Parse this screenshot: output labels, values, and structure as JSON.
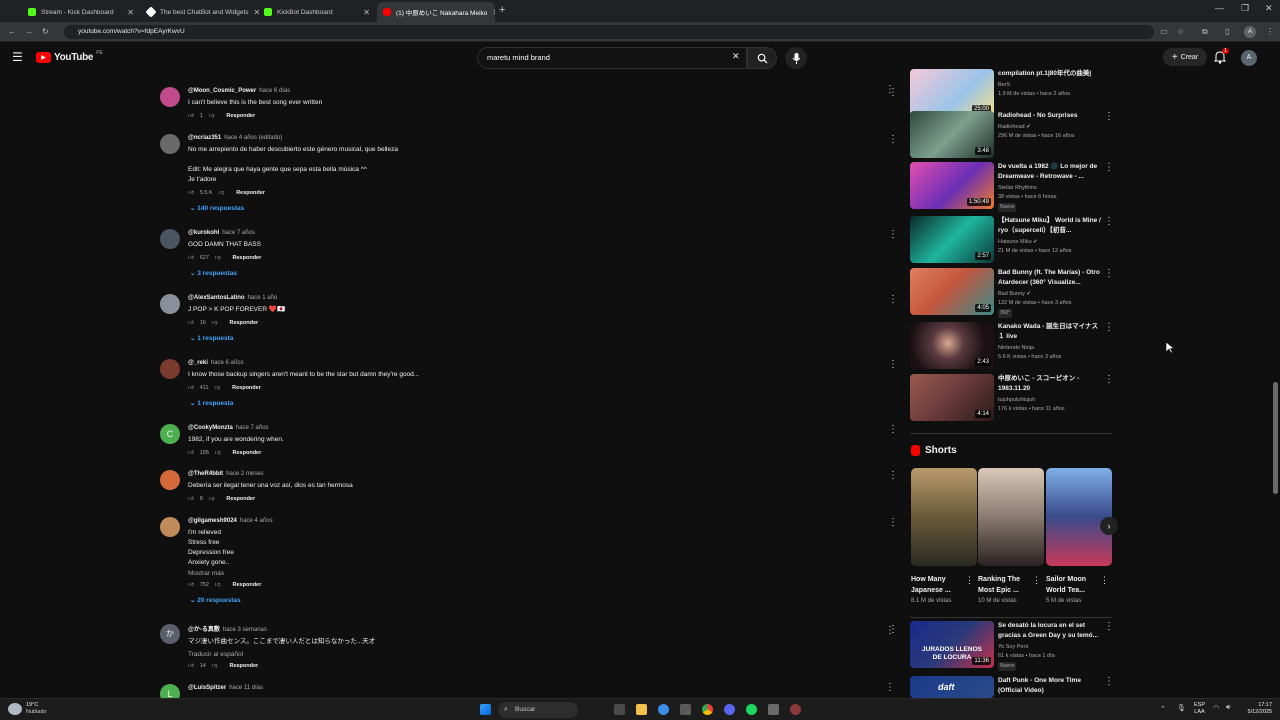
{
  "browser": {
    "tabs": [
      {
        "title": "Stream - Kick Dashboard",
        "color": "#53fc18"
      },
      {
        "title": "The best ChatBot and Widgets",
        "color": "#ffffff"
      },
      {
        "title": "KickBot Dashboard",
        "color": "#53fc18"
      },
      {
        "title": "(1) 中原めいこ Nakahara Meiko",
        "color": "#ff0000"
      }
    ],
    "url": "youtube.com/watch?v=fdpEAyrKwvU"
  },
  "header": {
    "logo": "YouTube",
    "region": "PE",
    "search_value": "maretu mind brand",
    "create_label": "Crear",
    "notif_count": "1",
    "account_initial": "A"
  },
  "comments": [
    {
      "author": "@Moon_Cosmic_Power",
      "time": "hace 6 días",
      "lines": [
        "I can't believe this is the best song ever written"
      ],
      "likes": "1",
      "reply_label": "Responder",
      "avatar_color": "#c04a8c"
    },
    {
      "author": "@ncriaz351",
      "time": "hace 4 años (editado)",
      "lines": [
        "No me arrepiento de haber descubierto este género musical, que belleza",
        "",
        "Edit: Me alegra que haya gente que sepa esta bella música ^^",
        "Je t'adore"
      ],
      "likes": "5.5 K",
      "reply_label": "Responder",
      "replies": "140 respuestas",
      "avatar_color": "#6a6a6a"
    },
    {
      "author": "@kurokohl",
      "time": "hace 7 años",
      "lines": [
        "GOD DAMN THAT BASS"
      ],
      "likes": "627",
      "reply_label": "Responder",
      "replies": "3 respuestas",
      "avatar_color": "#4a5560"
    },
    {
      "author": "@AlexSantosLatino",
      "time": "hace 1 año",
      "lines": [
        "J POP > K POP FOREVER ❤️🇯🇵"
      ],
      "likes": "16",
      "reply_label": "Responder",
      "replies": "1 respuesta",
      "avatar_color": "#8a8f99"
    },
    {
      "author": "@_reki",
      "time": "hace 6 años",
      "lines": [
        "I know those backup singers aren't meant to be the star but damn they're good..."
      ],
      "likes": "411",
      "reply_label": "Responder",
      "replies": "1 respuesta",
      "avatar_color": "#7a3b2e"
    },
    {
      "author": "@CookyMonzta",
      "time": "hace 7 años",
      "lines": [
        "1982, if you are wondering when."
      ],
      "likes": "195",
      "reply_label": "Responder",
      "avatar_color": "#4caf50",
      "avatar_letter": "C"
    },
    {
      "author": "@TheR4bbit",
      "time": "hace 2 meses",
      "lines": [
        "Debería ser ilegal tener una voz así, dios es tan hermosa"
      ],
      "likes": "8",
      "reply_label": "Responder",
      "avatar_color": "#d46a3a"
    },
    {
      "author": "@gilgamesh9024",
      "time": "hace 4 años",
      "lines": [
        "I'm relieved",
        "Stress free",
        "Depression free",
        "Anxiety gone.."
      ],
      "more": "Mostrar más",
      "likes": "752",
      "reply_label": "Responder",
      "replies": "20 respuestas",
      "avatar_color": "#c08a5a"
    },
    {
      "author": "@か-る真敷",
      "time": "hace 3 semanas",
      "lines": [
        "マジ凄い作曲センス。ここまで凄い人だとは知らなかった...天才"
      ],
      "translate": "Traducir al español",
      "likes": "14",
      "reply_label": "Responder",
      "avatar_color": "#5a5f6a",
      "avatar_letter": "か"
    },
    {
      "author": "@LuisSpitzer",
      "time": "hace 11 días",
      "lines": [],
      "likes": "",
      "reply_label": "",
      "avatar_color": "#4caf50",
      "avatar_letter": "L"
    }
  ],
  "sidebar": {
    "videos": [
      {
        "title": "compilation pt.1|80年代の曲美|",
        "channel": "BerS",
        "meta": "1.9 M de vistas • hace 2 años",
        "duration": "25:00",
        "color": "#9ac4e8"
      },
      {
        "title": "Radiohead - No Surprises",
        "channel": "Radiohead ✔",
        "meta": "296 M de vistas • hace 16 años",
        "duration": "3:48",
        "color": "#5d7a6a"
      },
      {
        "title": "De vuelta a 1982 🌑 Lo mejor de Dreamwave - Retrowave - ...",
        "channel": "Stellar Rhythms",
        "meta": "38 vistas • hace 6 horas",
        "badge": "Nuevo",
        "duration": "1:50:49",
        "color": "#8a3fb5"
      },
      {
        "title": "【Hatsune Miku】 World is Mine / ryo（supercell）【初音...",
        "channel": "Hatsune Miku ✔",
        "meta": "21 M de vistas • hace 12 años",
        "duration": "2:57",
        "color": "#1fb59e"
      },
      {
        "title": "Bad Bunny (ft. The Marías) - Otro Atardecer (360° Visualize...",
        "channel": "Bad Bunny ✔",
        "meta": "132 M de vistas • hace 3 años",
        "badge": "360°",
        "duration": "4:05",
        "color": "#c4563e"
      },
      {
        "title": "Kanako Wada - 誕生日はマイナス１ live",
        "channel": "Nintendo Ninja",
        "meta": "5.6 K vistas • hace 3 años",
        "duration": "2:43",
        "color": "#3a2a30"
      },
      {
        "title": "中原めいこ - スコーピオン - 1983.11.20",
        "channel": "tujuhpuluhtujuh",
        "meta": "176 k vistas • hace 11 años",
        "duration": "4:14",
        "color": "#6a3a3a"
      }
    ],
    "shorts_title": "Shorts",
    "shorts": [
      {
        "title": "How Many Japanese ...",
        "views": "8.1 M de vistas",
        "color": "#6a5a3a"
      },
      {
        "title": "Ranking The Most Epic ...",
        "views": "10 M de vistas",
        "color": "#5a4a44"
      },
      {
        "title": "Sailor Moon World Tea...",
        "views": "5 M de vistas",
        "color": "#3a4a8a"
      }
    ],
    "bottom_videos": [
      {
        "title": "Se desató la locura en el set gracias a Green Day y su temó...",
        "channel": "Yo Soy Perú",
        "meta": "61 k vistas • hace 1 día",
        "badge": "Nuevo",
        "duration": "11:36",
        "color": "#2a3a7a",
        "thumb_text": "JURADOS LLENOS DE LOCURA"
      },
      {
        "title": "Daft Punk - One More Time (Official Video)",
        "channel": "",
        "meta": "",
        "duration": "",
        "color": "#2a4a8a",
        "thumb_text": "daft"
      }
    ]
  },
  "taskbar": {
    "weather_temp": "19°C",
    "weather_desc": "Nublado",
    "search_label": "Buscar",
    "lang": "ESP",
    "lang2": "LAA",
    "time": "17:17",
    "date": "5/12/2025"
  }
}
